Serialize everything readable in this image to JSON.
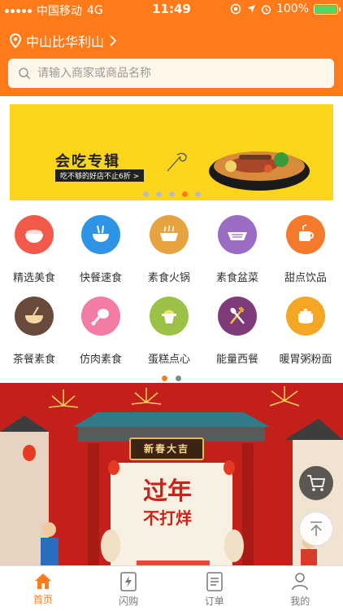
{
  "status_bar": {
    "carrier": "中国移动",
    "network": "4G",
    "time": "11:49",
    "battery": "100%"
  },
  "location": {
    "text": "中山比华利山"
  },
  "search": {
    "placeholder": "请输入商家或商品名称"
  },
  "banner": {
    "title": "会吃专辑",
    "subtitle": "吃不够的好店不止6折 >",
    "slide_count": 5,
    "active_slide": 3
  },
  "categories": [
    {
      "label": "精选美食",
      "icon": "bowl-rice-icon",
      "color": "#f15a4a"
    },
    {
      "label": "快餐速食",
      "icon": "noodle-bowl-icon",
      "color": "#2f93e6"
    },
    {
      "label": "素食火锅",
      "icon": "hotpot-icon",
      "color": "#e8a341"
    },
    {
      "label": "素食盆菜",
      "icon": "basin-icon",
      "color": "#9a6cc4"
    },
    {
      "label": "甜点饮品",
      "icon": "cup-icon",
      "color": "#f47a2c"
    },
    {
      "label": "茶餐素食",
      "icon": "soup-icon",
      "color": "#6a4a3c"
    },
    {
      "label": "仿肉素食",
      "icon": "drumstick-icon",
      "color": "#f37ca2"
    },
    {
      "label": "蛋糕点心",
      "icon": "juicer-icon",
      "color": "#9bc247"
    },
    {
      "label": "能量西餐",
      "icon": "fork-spoon-icon",
      "color": "#7d3b7a"
    },
    {
      "label": "暖胃粥粉面",
      "icon": "pot-icon",
      "color": "#f5a623"
    }
  ],
  "category_pager": {
    "pages": 2,
    "active": 0
  },
  "promo": {
    "sign": "新春大吉",
    "headline": "过年",
    "headline2": "不打烊"
  },
  "tabs": [
    {
      "label": "首页",
      "icon": "home-icon",
      "active": true
    },
    {
      "label": "闪购",
      "icon": "flash-icon",
      "active": false
    },
    {
      "label": "订单",
      "icon": "order-icon",
      "active": false
    },
    {
      "label": "我的",
      "icon": "user-icon",
      "active": false
    }
  ],
  "colors": {
    "accent": "#ff7a18",
    "banner_bg": "#fbd51c",
    "promo_bg": "#c31f1b"
  }
}
